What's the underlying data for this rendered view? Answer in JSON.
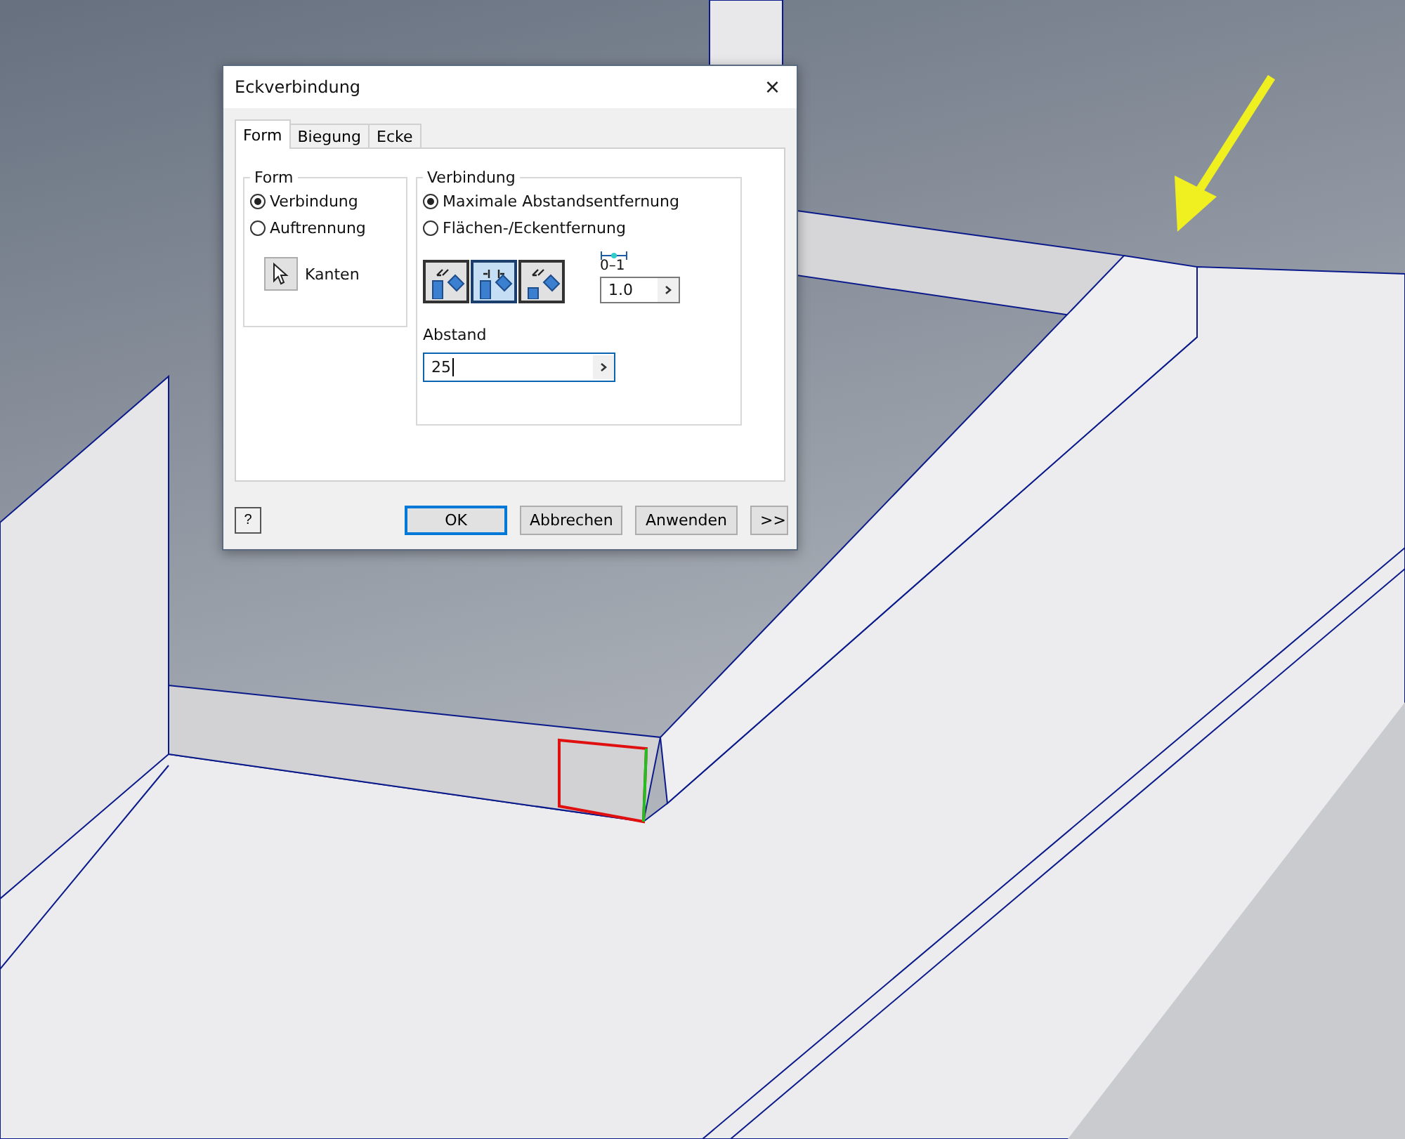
{
  "window": {
    "title": "Eckverbindung",
    "close": "×"
  },
  "tabs": [
    {
      "label": "Form",
      "selected": true
    },
    {
      "label": "Biegung",
      "selected": false
    },
    {
      "label": "Ecke",
      "selected": false
    }
  ],
  "form_group": {
    "title": "Form",
    "options": [
      {
        "label": "Verbindung",
        "selected": true
      },
      {
        "label": "Auftrennung",
        "selected": false
      }
    ],
    "select_button": "Kanten"
  },
  "connection_group": {
    "title": "Verbindung",
    "options": [
      {
        "label": "Maximale Abstandsentfernung",
        "selected": true
      },
      {
        "label": "Flächen-/Eckentfernung",
        "selected": false
      }
    ],
    "styles": [
      {
        "selected": false
      },
      {
        "selected": true
      },
      {
        "selected": false
      }
    ],
    "scale_caption": "0–1",
    "scale_value": "1.0",
    "distance_label": "Abstand",
    "distance_value": "25"
  },
  "help": "?",
  "buttons": [
    {
      "label": "OK",
      "default": true
    },
    {
      "label": "Abbrechen",
      "default": false
    },
    {
      "label": "Anwenden",
      "default": false
    },
    {
      "label": ">>",
      "default": false
    }
  ]
}
